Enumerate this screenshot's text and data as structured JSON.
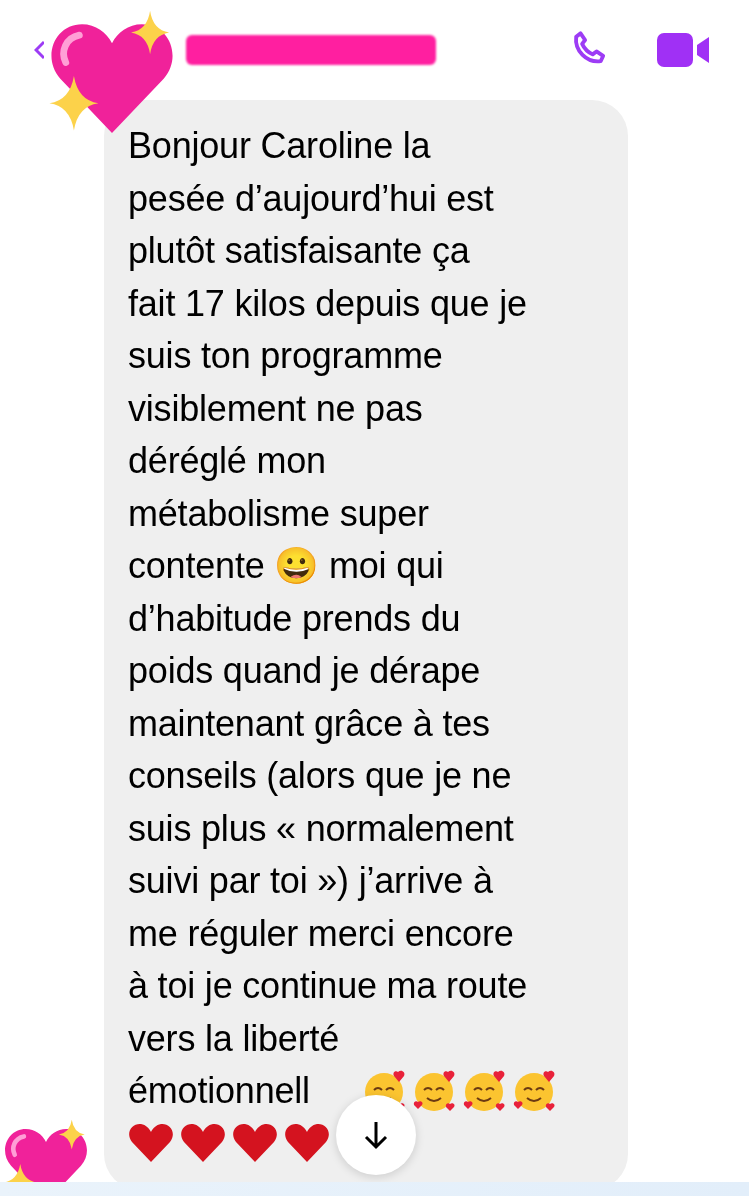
{
  "header": {
    "name_redacted": true
  },
  "message": {
    "text": "Bonjour Caroline la\npesée d’aujourd’hui est\nplutôt satisfaisante ça\nfait 17 kilos depuis que je\nsuis ton programme\nvisiblement ne pas\ndéréglé mon\nmétabolisme super\ncontente 😀 moi qui\nd’habitude prends du\npoids quand je dérape\nmaintenant grâce à tes\nconseils (alors que je ne\nsuis plus « normalement\nsuivi par toi ») j’arrive à\nme réguler merci encore\nà toi je continue ma route\nvers la liberté",
    "cut_text": "émotionnell",
    "trailing_emojis": [
      {
        "kind": "smiling-hearts"
      },
      {
        "kind": "smiling-hearts"
      },
      {
        "kind": "smiling-hearts"
      },
      {
        "kind": "smiling-hearts"
      }
    ],
    "emoji_line": [
      {
        "kind": "heart"
      },
      {
        "kind": "heart"
      },
      {
        "kind": "heart"
      },
      {
        "kind": "heart"
      }
    ]
  }
}
